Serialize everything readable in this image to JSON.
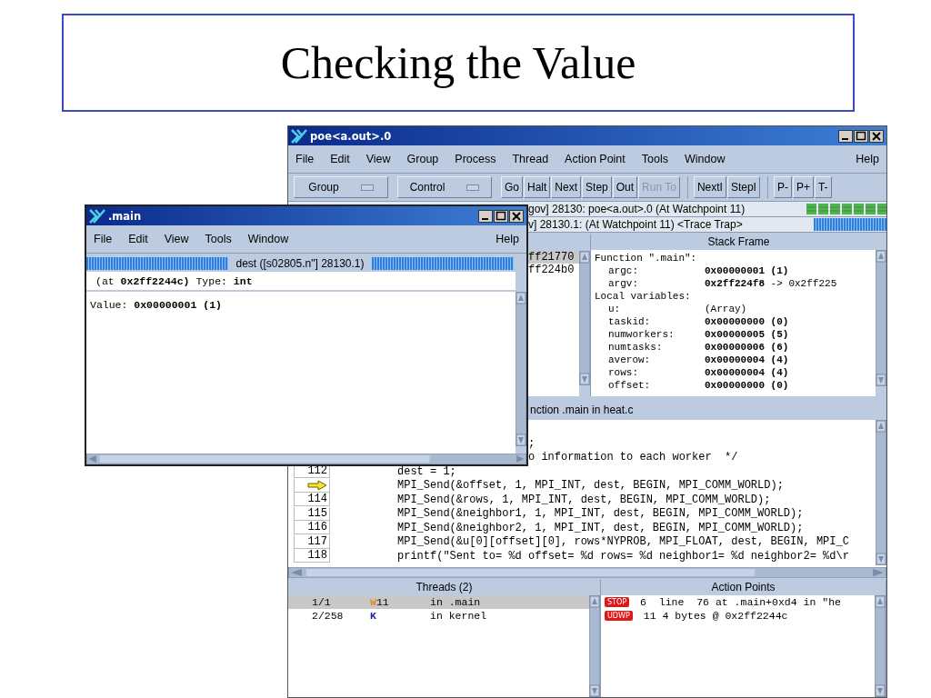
{
  "slide": {
    "title": "Checking the Value"
  },
  "process_window": {
    "title": "poe<a.out>.0",
    "menus": [
      "File",
      "Edit",
      "View",
      "Group",
      "Process",
      "Thread",
      "Action Point",
      "Tools",
      "Window"
    ],
    "help_menu": "Help",
    "dropdowns": [
      "Group",
      "Control"
    ],
    "button_groups": [
      [
        {
          "label": "Go",
          "disabled": false
        },
        {
          "label": "Halt",
          "disabled": false
        },
        {
          "label": "Next",
          "disabled": false
        },
        {
          "label": "Step",
          "disabled": false
        },
        {
          "label": "Out",
          "disabled": false
        },
        {
          "label": "Run To",
          "disabled": true
        }
      ],
      [
        {
          "label": "NextI",
          "disabled": false
        },
        {
          "label": "StepI",
          "disabled": false
        }
      ],
      [
        {
          "label": "P-",
          "disabled": false
        },
        {
          "label": "P+",
          "disabled": false
        },
        {
          "label": "T-",
          "disabled": false
        }
      ]
    ],
    "process_status": "gov] 28130: poe<a.out>.0 (At Watchpoint 11)",
    "thread_status": "v] 28130.1:  (At Watchpoint 11) <Trace Trap>",
    "stack_trace": [
      {
        "text": "ff21770",
        "selected": true
      },
      {
        "text": "ff224b0",
        "selected": false
      }
    ],
    "stack_frame": {
      "title": "Stack Frame",
      "lines": [
        {
          "kind": "header",
          "label": "Function \".main\":"
        },
        {
          "kind": "var",
          "label": "argc:",
          "value": "**0x00000001 (1)**"
        },
        {
          "kind": "var",
          "label": "argv:",
          "value": "**0x2ff224f8** -> 0x2ff225"
        },
        {
          "kind": "header",
          "label": "Local variables:"
        },
        {
          "kind": "var",
          "label": "u:",
          "value": "(Array)"
        },
        {
          "kind": "var",
          "label": "taskid:",
          "value": "**0x00000000 (0)**"
        },
        {
          "kind": "var",
          "label": "numworkers:",
          "value": "**0x00000005 (5)**"
        },
        {
          "kind": "var",
          "label": "numtasks:",
          "value": "**0x00000006 (6)**"
        },
        {
          "kind": "var",
          "label": "averow:",
          "value": "**0x00000004 (4)**"
        },
        {
          "kind": "var",
          "label": "rows:",
          "value": "**0x00000004 (4)**"
        },
        {
          "kind": "var",
          "label": "offset:",
          "value": "**0x00000000 (0)**"
        }
      ]
    },
    "source_title": "nction .main in heat.c",
    "code_lines": [
      {
        "kind": "partial",
        "text": ";"
      },
      {
        "kind": "partial",
        "text": "o information to each worker  */"
      },
      {
        "kind": "line",
        "number": "112",
        "text": "dest = 1;",
        "current": false
      },
      {
        "kind": "line",
        "text": "MPI_Send(&offset, 1, MPI_INT, dest, BEGIN, MPI_COMM_WORLD);",
        "current": true
      },
      {
        "kind": "line",
        "number": "114",
        "text": "MPI_Send(&rows, 1, MPI_INT, dest, BEGIN, MPI_COMM_WORLD);",
        "current": false
      },
      {
        "kind": "line",
        "number": "115",
        "text": "MPI_Send(&neighbor1, 1, MPI_INT, dest, BEGIN, MPI_COMM_WORLD);",
        "current": false
      },
      {
        "kind": "line",
        "number": "116",
        "text": "MPI_Send(&neighbor2, 1, MPI_INT, dest, BEGIN, MPI_COMM_WORLD);",
        "current": false
      },
      {
        "kind": "line",
        "number": "117",
        "text": "MPI_Send(&u[0][offset][0], rows*NYPROB, MPI_FLOAT, dest, BEGIN, MPI_C",
        "current": false
      },
      {
        "kind": "line",
        "number": "118",
        "text": "printf(\"Sent to= %d offset= %d rows= %d neighbor1= %d neighbor2= %d\\r",
        "current": false
      }
    ],
    "threads": {
      "title": "Threads (2)",
      "rows": [
        {
          "id": "1/1",
          "state": "W",
          "color": "#e08a1e",
          "detail": "11",
          "location": "in .main",
          "selected": true
        },
        {
          "id": "2/258",
          "state": "K",
          "color": "#2020a0",
          "location": "in kernel",
          "selected": false
        }
      ]
    },
    "action_points": {
      "title": "Action Points",
      "rows": [
        {
          "badge": "STOP",
          "text": "6  line  76 at .main+0xd4 in \"he"
        },
        {
          "badge": "UDWP",
          "text": "11 4 bytes @ 0x2ff2244c"
        }
      ]
    }
  },
  "variable_window": {
    "title": ".main",
    "menus": [
      "File",
      "Edit",
      "View",
      "Tools",
      "Window"
    ],
    "help_menu": "Help",
    "header": "dest ([s02805.n\"] 28130.1)",
    "address_line": "(at **0x2ff2244c)** Type: **int**",
    "value_line": "Value: **0x00000001 (1)**"
  }
}
